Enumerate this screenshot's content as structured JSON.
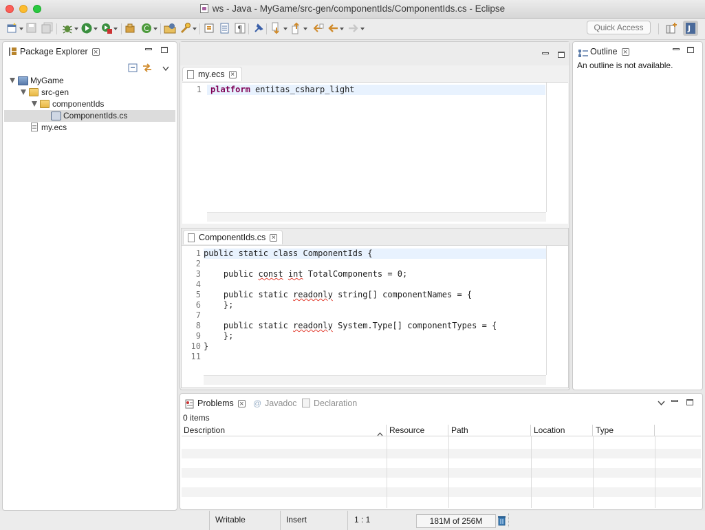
{
  "window": {
    "title": "ws - Java - MyGame/src-gen/componentIds/ComponentIds.cs - Eclipse"
  },
  "toolbar": {
    "quick_access_placeholder": "Quick Access",
    "icons": [
      "new-icon",
      "save-icon",
      "save-all-icon",
      "debug-icon",
      "run-icon",
      "external-tools-icon",
      "new-package-icon",
      "new-class-icon",
      "open-type-icon",
      "search-icon",
      "toggle-ant-icon",
      "mark-occurrences-icon",
      "show-whitespace-icon",
      "pin-icon",
      "next-annotation-icon",
      "previous-annotation-icon",
      "last-edit-icon",
      "back-icon",
      "forward-icon",
      "open-perspective-icon",
      "java-perspective-icon"
    ]
  },
  "package_explorer": {
    "title": "Package Explorer",
    "tree": [
      {
        "label": "MyGame",
        "type": "project",
        "level": 0,
        "expanded": true
      },
      {
        "label": "src-gen",
        "type": "folder",
        "level": 1,
        "expanded": true
      },
      {
        "label": "componentIds",
        "type": "folder",
        "level": 2,
        "expanded": true
      },
      {
        "label": "ComponentIds.cs",
        "type": "cs-file",
        "level": 3,
        "selected": true
      },
      {
        "label": "my.ecs",
        "type": "file",
        "level": 1
      }
    ]
  },
  "editor_top": {
    "tab_label": "my.ecs",
    "lines": [
      {
        "num": "1",
        "parts": [
          {
            "t": "platform",
            "kw": true
          },
          {
            "t": " entitas_csharp_light"
          }
        ]
      }
    ]
  },
  "editor_bottom": {
    "tab_label": "ComponentIds.cs",
    "lines": [
      {
        "num": "1",
        "parts": [
          {
            "t": "public static class ComponentIds {"
          }
        ]
      },
      {
        "num": "2",
        "parts": []
      },
      {
        "num": "3",
        "parts": [
          {
            "t": "    public "
          },
          {
            "t": "const",
            "sq": true
          },
          {
            "t": " "
          },
          {
            "t": "int",
            "sq": true
          },
          {
            "t": " TotalComponents = 0;"
          }
        ]
      },
      {
        "num": "4",
        "parts": []
      },
      {
        "num": "5",
        "parts": [
          {
            "t": "    public static "
          },
          {
            "t": "readonly",
            "sq": true
          },
          {
            "t": " string[] componentNames = {"
          }
        ]
      },
      {
        "num": "6",
        "parts": [
          {
            "t": "    };"
          }
        ]
      },
      {
        "num": "7",
        "parts": []
      },
      {
        "num": "8",
        "parts": [
          {
            "t": "    public static "
          },
          {
            "t": "readonly",
            "sq": true
          },
          {
            "t": " System.Type[] componentTypes = {"
          }
        ]
      },
      {
        "num": "9",
        "parts": [
          {
            "t": "    };"
          }
        ]
      },
      {
        "num": "10",
        "parts": [
          {
            "t": "}"
          }
        ]
      },
      {
        "num": "11",
        "parts": []
      }
    ]
  },
  "outline": {
    "title": "Outline",
    "message": "An outline is not available."
  },
  "bottom_panel": {
    "tabs": [
      "Problems",
      "Javadoc",
      "Declaration"
    ],
    "items_count": "0 items",
    "columns": [
      "Description",
      "Resource",
      "Path",
      "Location",
      "Type"
    ]
  },
  "status": {
    "writable": "Writable",
    "insert_mode": "Insert",
    "position": "1 : 1",
    "heap": "181M of 256M"
  }
}
